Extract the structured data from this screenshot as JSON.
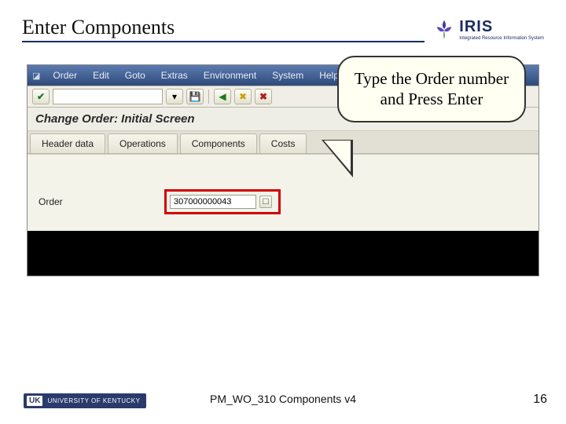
{
  "slide": {
    "title": "Enter Components",
    "callout": "Type the Order number and Press Enter",
    "footer_text": "PM_WO_310 Components v4",
    "page_number": "16",
    "brand": "IRIS",
    "brand_sub": "Integrated Resource Information System",
    "uni_short": "UK",
    "uni_full": "UNIVERSITY OF KENTUCKY"
  },
  "sap": {
    "menu": [
      "Order",
      "Edit",
      "Goto",
      "Extras",
      "Environment",
      "System",
      "Help"
    ],
    "screen_title": "Change Order: Initial Screen",
    "tabs": [
      "Header data",
      "Operations",
      "Components",
      "Costs"
    ],
    "order_label": "Order",
    "order_value": "307000000043"
  }
}
